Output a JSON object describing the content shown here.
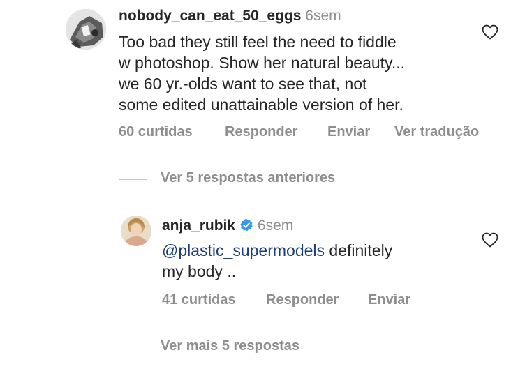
{
  "comment": {
    "username": "nobody_can_eat_50_eggs",
    "time": "6sem",
    "text_lines": [
      "Too bad they still feel the need to fiddle",
      "w photoshop. Show her natural beauty...",
      "we 60 yr.-olds want to see that, not",
      "some edited unattainable version of her."
    ],
    "likes_label": "60 curtidas",
    "reply_label": "Responder",
    "send_label": "Enviar",
    "translate_label": "Ver tradução",
    "like_icon": "heart-outline-icon"
  },
  "previous_replies_label": "Ver 5 respostas anteriores",
  "reply": {
    "username": "anja_rubik",
    "verified_icon": "verified-badge-icon",
    "verified_color": "#3897f0",
    "time": "6sem",
    "mention": "@plastic_supermodels",
    "text_after_mention": " definitely",
    "text_line2": "my body ..",
    "likes_label": "41 curtidas",
    "reply_label": "Responder",
    "send_label": "Enviar",
    "like_icon": "heart-outline-icon"
  },
  "more_replies_label": "Ver mais 5 respostas",
  "colors": {
    "text": "#262626",
    "muted": "#8e8e8e",
    "mention": "#1c3f79"
  }
}
